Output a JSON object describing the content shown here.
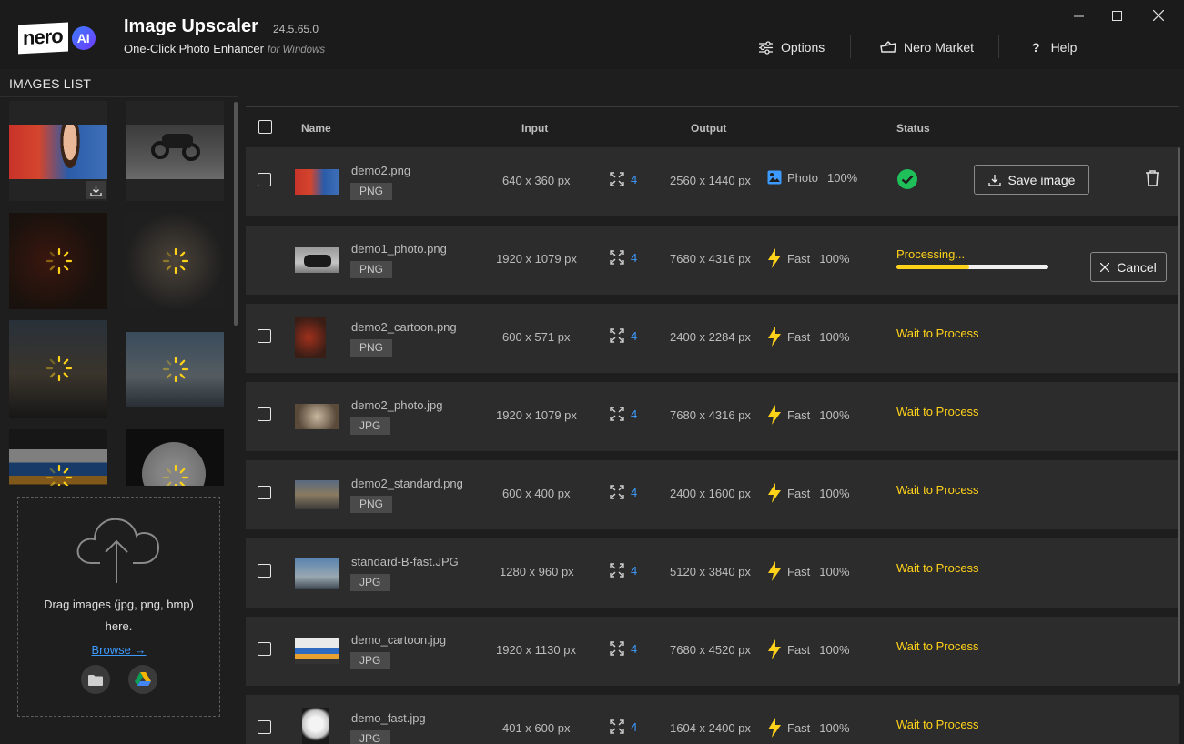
{
  "header": {
    "logo_text": "nero",
    "logo_badge": "AI",
    "title": "Image Upscaler",
    "version": "24.5.65.0",
    "subtitle": "One-Click Photo Enhancer",
    "subtitle_suffix": "for Windows",
    "options_label": "Options",
    "market_label": "Nero Market",
    "help_label": "Help"
  },
  "left": {
    "title": "IMAGES LIST",
    "drop_text_1": "Drag images (jpg, png, bmp)",
    "drop_text_2": "here.",
    "browse_label": "Browse →"
  },
  "table": {
    "headers": {
      "name": "Name",
      "input": "Input",
      "output": "Output",
      "status": "Status"
    },
    "rows": [
      {
        "name": "demo2.png",
        "ext": "PNG",
        "input": "640 x 360 px",
        "scale": "4",
        "output": "2560 x 1440 px",
        "mode": "Photo",
        "mode_icon": "photo-icon",
        "percent": "100%",
        "status": "done",
        "action_label": "Save image"
      },
      {
        "name": "demo1_photo.png",
        "ext": "PNG",
        "input": "1920 x 1079 px",
        "scale": "4",
        "output": "7680 x 4316 px",
        "mode": "Fast",
        "mode_icon": "lightning-icon",
        "percent": "100%",
        "status": "Processing...",
        "progress": 0.48,
        "action_label": "Cancel"
      },
      {
        "name": "demo2_cartoon.png",
        "ext": "PNG",
        "input": "600 x 571 px",
        "scale": "4",
        "output": "2400 x 2284 px",
        "mode": "Fast",
        "mode_icon": "lightning-icon",
        "percent": "100%",
        "status": "Wait to Process"
      },
      {
        "name": "demo2_photo.jpg",
        "ext": "JPG",
        "input": "1920 x 1079 px",
        "scale": "4",
        "output": "7680 x 4316 px",
        "mode": "Fast",
        "mode_icon": "lightning-icon",
        "percent": "100%",
        "status": "Wait to Process"
      },
      {
        "name": "demo2_standard.png",
        "ext": "PNG",
        "input": "600 x 400 px",
        "scale": "4",
        "output": "2400 x 1600 px",
        "mode": "Fast",
        "mode_icon": "lightning-icon",
        "percent": "100%",
        "status": "Wait to Process"
      },
      {
        "name": "standard-B-fast.JPG",
        "ext": "JPG",
        "input": "1280 x 960 px",
        "scale": "4",
        "output": "5120 x 3840 px",
        "mode": "Fast",
        "mode_icon": "lightning-icon",
        "percent": "100%",
        "status": "Wait to Process"
      },
      {
        "name": "demo_cartoon.jpg",
        "ext": "JPG",
        "input": "1920 x 1130 px",
        "scale": "4",
        "output": "7680 x 4520 px",
        "mode": "Fast",
        "mode_icon": "lightning-icon",
        "percent": "100%",
        "status": "Wait to Process"
      },
      {
        "name": "demo_fast.jpg",
        "ext": "JPG",
        "input": "401 x 600 px",
        "scale": "4",
        "output": "1604 x 2400 px",
        "mode": "Fast",
        "mode_icon": "lightning-icon",
        "percent": "100%",
        "status": "Wait to Process"
      }
    ]
  },
  "colors": {
    "accent_blue": "#3d9bff",
    "status_yellow": "#ffd21a",
    "success_green": "#1fbf5a"
  }
}
